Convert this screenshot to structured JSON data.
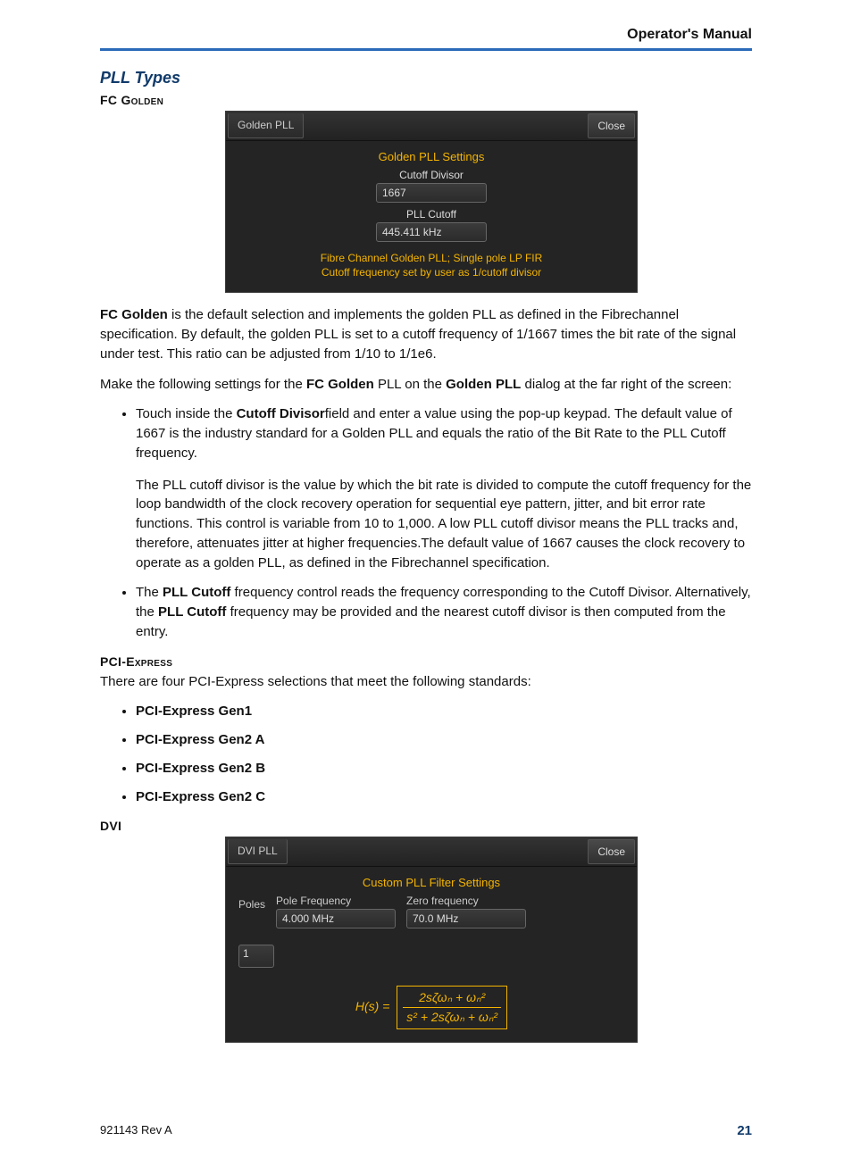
{
  "header": {
    "manual_title": "Operator's Manual"
  },
  "footer": {
    "doc_id": "921143 Rev A",
    "page_number": "21"
  },
  "section": {
    "title": "PLL Types",
    "fc_golden_heading": "FC Golden",
    "pci_express_heading": "PCI-Express",
    "dvi_heading": "DVI"
  },
  "dialog_golden": {
    "tab": "Golden PLL",
    "close": "Close",
    "settings_title": "Golden PLL Settings",
    "cutoff_divisor_label": "Cutoff Divisor",
    "cutoff_divisor_value": "1667",
    "pll_cutoff_label": "PLL Cutoff",
    "pll_cutoff_value": "445.411 kHz",
    "desc_line1": "Fibre Channel Golden PLL; Single pole LP FIR",
    "desc_line2": "Cutoff frequency set by user as 1/cutoff divisor"
  },
  "dialog_dvi": {
    "tab": "DVI PLL",
    "close": "Close",
    "settings_title": "Custom PLL Filter Settings",
    "poles_label": "Poles",
    "poles_value": "1",
    "pole_freq_label": "Pole Frequency",
    "pole_freq_value": "4.000 MHz",
    "zero_freq_label": "Zero frequency",
    "zero_freq_value": "70.0 MHz",
    "formula_lhs": "H(s) =",
    "formula_numerator": "2sζωₙ + ωₙ²",
    "formula_denominator": "s² + 2sζωₙ + ωₙ²"
  },
  "body": {
    "fc_golden_intro_prefix_bold": "FC Golden",
    "fc_golden_intro_rest": " is the default selection and implements the golden PLL as defined in the Fibrechannel specification. By default, the golden PLL is set to a cutoff frequency of 1/1667 times the bit rate of the signal under test. This ratio can be adjusted from 1/10 to 1/1e6.",
    "fc_settings_sentence_pre": "Make the following settings for the ",
    "fc_settings_bold1": "FC Golden",
    "fc_settings_mid": " PLL on the ",
    "fc_settings_bold2": "Golden PLL",
    "fc_settings_post": " dialog at the far right of the screen:",
    "bullet1_pre": "Touch inside the ",
    "bullet1_bold": "Cutoff Divisor",
    "bullet1_post": "field and enter a value using the pop-up keypad. The default value of 1667 is the industry standard for a Golden PLL and equals the ratio of the Bit Rate to the PLL Cutoff frequency.",
    "bullet1_para2": "The PLL cutoff divisor is the value by which the bit rate is divided to compute the cutoff frequency for the loop bandwidth of the clock recovery operation for sequential eye pattern, jitter, and bit error rate functions. This control is variable from 10 to 1,000. A low PLL cutoff divisor means the PLL tracks and, therefore, attenuates jitter at higher frequencies.The default value of 1667 causes the clock recovery to operate as a golden PLL, as defined in the Fibrechannel specification.",
    "bullet2_pre": "The ",
    "bullet2_bold1": "PLL Cutoff",
    "bullet2_mid": " frequency control reads the frequency corresponding to the Cutoff Divisor. Alternatively, the ",
    "bullet2_bold2": "PLL Cutoff",
    "bullet2_post": " frequency may be provided and the nearest cutoff divisor is then computed from the entry.",
    "pci_intro": "There are four PCI-Express selections that meet the following standards:",
    "pci_items": [
      "PCI-Express Gen1",
      "PCI-Express Gen2 A",
      "PCI-Express Gen2 B",
      "PCI-Express Gen2 C"
    ]
  }
}
